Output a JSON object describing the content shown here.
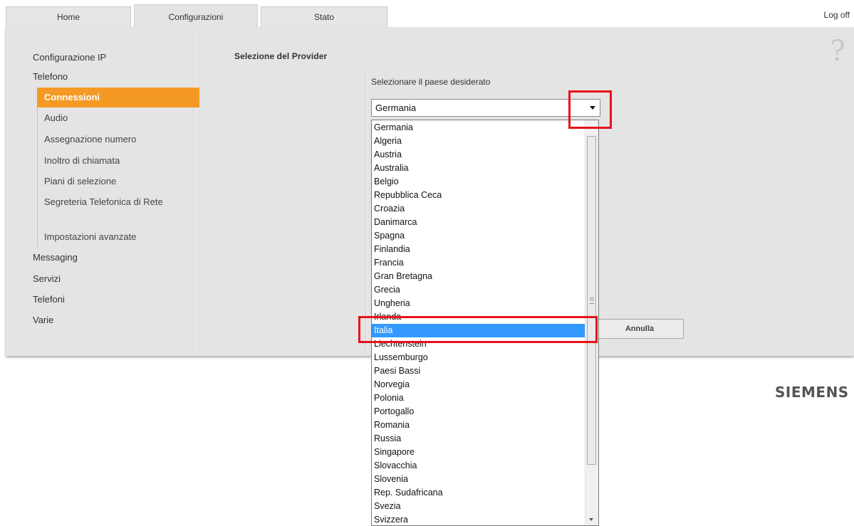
{
  "tabs": [
    {
      "label": "Home"
    },
    {
      "label": "Configurazioni"
    },
    {
      "label": "Stato"
    }
  ],
  "logoff": "Log off",
  "help_icon": "?",
  "nav": {
    "top": [
      "Configurazione IP",
      "Telefono"
    ],
    "sub": [
      "Connessioni",
      "Audio",
      "Assegnazione numero",
      "Inoltro di chiamata",
      "Piani di selezione",
      "Segreteria Telefonica di Rete",
      "Impostazioni avanzate"
    ],
    "bottom": [
      "Messaging",
      "Servizi",
      "Telefoni",
      "Varie"
    ]
  },
  "section_title": "Selezione del Provider",
  "prompt": "Selezionare il paese desiderato",
  "select": {
    "value": "Germania"
  },
  "cancel_label": "Annulla",
  "dropdown_options": [
    "Germania",
    "Algeria",
    "Austria",
    "Australia",
    "Belgio",
    "Repubblica Ceca",
    "Croazia",
    "Danimarca",
    "Spagna",
    "Finlandia",
    "Francia",
    "Gran Bretagna",
    "Grecia",
    "Ungheria",
    "Irlanda",
    "Italia",
    "Liechtenstein",
    "Lussemburgo",
    "Paesi Bassi",
    "Norvegia",
    "Polonia",
    "Portogallo",
    "Romania",
    "Russia",
    "Singapore",
    "Slovacchia",
    "Slovenia",
    "Rep. Sudafricana",
    "Svezia",
    "Svizzera"
  ],
  "brand": "SIEMENS",
  "colors": {
    "active_nav": "#f49a24",
    "selected_option": "#3399ff",
    "highlight": "#e8101a",
    "panel_bg": "#e4e4e4"
  }
}
